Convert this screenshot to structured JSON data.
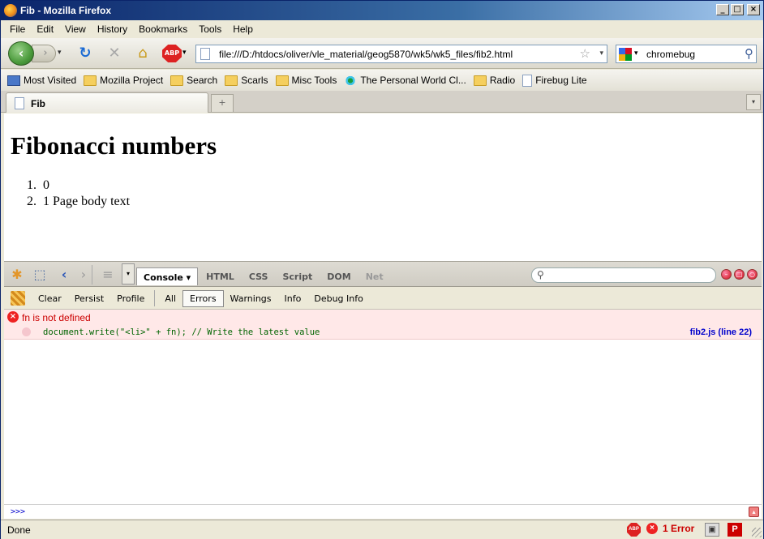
{
  "window": {
    "title": "Fib - Mozilla Firefox"
  },
  "menubar": {
    "items": [
      {
        "label": "File",
        "key": "F"
      },
      {
        "label": "Edit",
        "key": "E"
      },
      {
        "label": "View",
        "key": "V"
      },
      {
        "label": "History",
        "key": "s"
      },
      {
        "label": "Bookmarks",
        "key": "B"
      },
      {
        "label": "Tools",
        "key": "T"
      },
      {
        "label": "Help",
        "key": "H"
      }
    ]
  },
  "navbar": {
    "url": "file:///D:/htdocs/oliver/vle_material/geog5870/wk5/wk5_files/fib2.html",
    "search_value": "chromebug",
    "abp_label": "ABP"
  },
  "bookmarks": {
    "items": [
      {
        "label": "Most Visited",
        "icon": "most-visited-icon"
      },
      {
        "label": "Mozilla Project",
        "icon": "folder-icon"
      },
      {
        "label": "Search",
        "icon": "folder-icon"
      },
      {
        "label": "Scarls",
        "icon": "folder-icon"
      },
      {
        "label": "Misc Tools",
        "icon": "folder-icon"
      },
      {
        "label": "The Personal World Cl...",
        "icon": "star-burst-icon"
      },
      {
        "label": "Radio",
        "icon": "folder-icon"
      },
      {
        "label": "Firebug Lite",
        "icon": "page-icon"
      }
    ]
  },
  "tabs": {
    "active_label": "Fib",
    "new_tab_symbol": "+"
  },
  "page": {
    "heading": "Fibonacci numbers",
    "list": [
      {
        "num": "1.",
        "text": "0"
      },
      {
        "num": "2.",
        "text": "1 Page body text"
      }
    ]
  },
  "firebug": {
    "console_tab": "Console ▾",
    "tabs": [
      "HTML",
      "CSS",
      "Script",
      "DOM",
      "Net"
    ],
    "sub_buttons": {
      "clear": "Clear",
      "persist": "Persist",
      "profile": "Profile",
      "all": "All",
      "errors": "Errors",
      "warnings": "Warnings",
      "info": "Info",
      "debug_info": "Debug Info"
    },
    "error": {
      "message": "fn is not defined",
      "code": "document.write(\"<li>\" + fn); // Write the latest value",
      "location": "fib2.js (line 22)"
    },
    "prompt": ">>>"
  },
  "statusbar": {
    "text": "Done",
    "error_count": "1 Error",
    "abp_label": "ABP",
    "p_label": "P"
  },
  "colors": {
    "error_red": "#cc0000",
    "error_bg": "#ffe8e8",
    "code_green": "#006400",
    "link_blue": "#0000cc"
  }
}
